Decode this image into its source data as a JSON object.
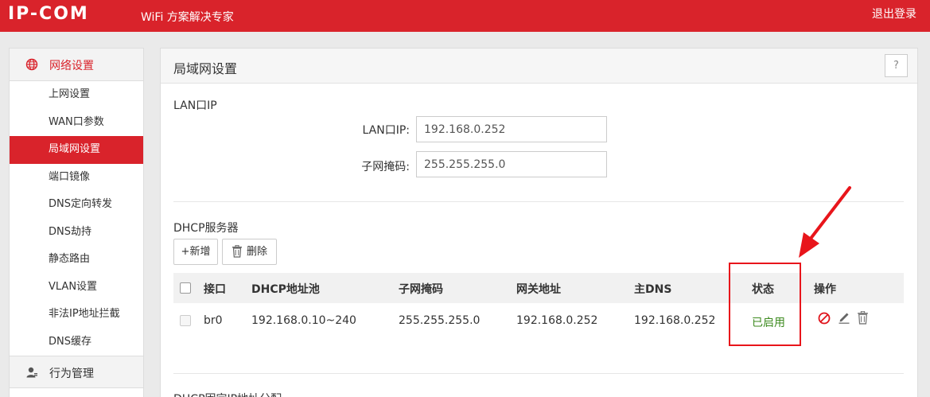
{
  "header": {
    "brand": "IP-COM",
    "slogan": "WiFi 方案解决专家",
    "logout_label": "退出登录",
    "accent_color": "#d9232b"
  },
  "sidebar": {
    "group_network": {
      "label": "网络设置",
      "icon": "globe-icon"
    },
    "items": [
      {
        "label": "上网设置"
      },
      {
        "label": "WAN口参数"
      },
      {
        "label": "局域网设置"
      },
      {
        "label": "端口镜像"
      },
      {
        "label": "DNS定向转发"
      },
      {
        "label": "DNS劫持"
      },
      {
        "label": "静态路由"
      },
      {
        "label": "VLAN设置"
      },
      {
        "label": "非法IP地址拦截"
      },
      {
        "label": "DNS缓存"
      }
    ],
    "group_behavior": {
      "label": "行为管理",
      "icon": "user-icon"
    }
  },
  "panel": {
    "title": "局域网设置",
    "help_label": "?",
    "lan_section": {
      "heading": "LAN口IP",
      "ip_label": "LAN口IP:",
      "ip_value": "192.168.0.252",
      "mask_label": "子网掩码:",
      "mask_value": "255.255.255.0"
    },
    "dhcp_section": {
      "heading": "DHCP服务器",
      "add_label": "+新增",
      "delete_label": "删除",
      "columns": [
        "接口",
        "DHCP地址池",
        "子网掩码",
        "网关地址",
        "主DNS",
        "状态",
        "操作"
      ],
      "rows": [
        {
          "interface": "br0",
          "pool": "192.168.0.10~240",
          "mask": "255.255.255.0",
          "gateway": "192.168.0.252",
          "dns": "192.168.0.252",
          "status": "已启用",
          "status_color": "#3c8a1e"
        }
      ]
    },
    "next_section_heading": "DHCP固定IP地址分配"
  },
  "annotation_color": "#e8151b"
}
